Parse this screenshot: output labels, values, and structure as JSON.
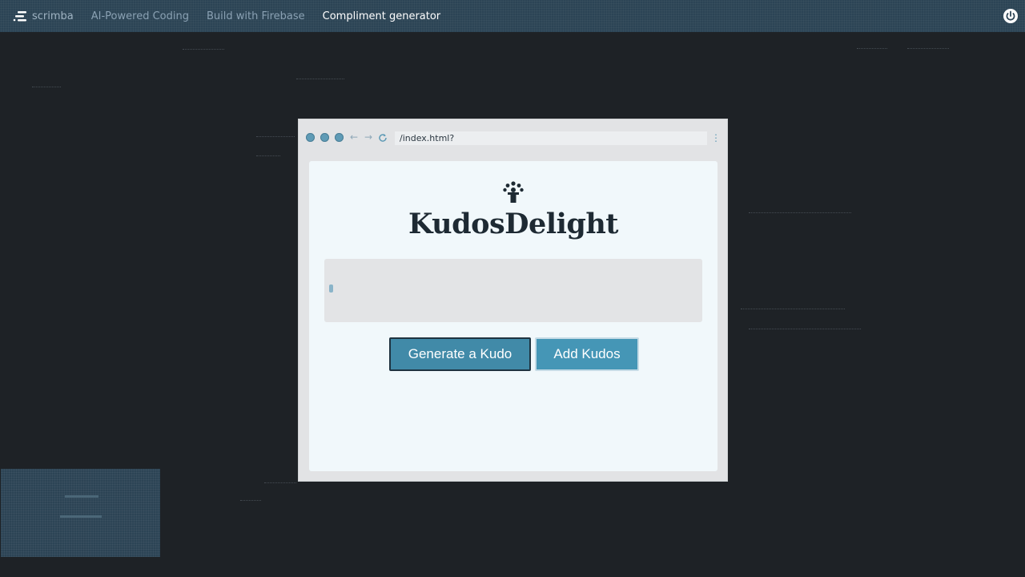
{
  "header": {
    "brand": "scrimba",
    "breadcrumbs": [
      {
        "label": "AI-Powered Coding"
      },
      {
        "label": "Build with Firebase"
      },
      {
        "label": "Compliment generator"
      }
    ]
  },
  "preview": {
    "url": "/index.html?",
    "app": {
      "title": "KudosDelight",
      "textarea_value": "",
      "buttons": {
        "generate": "Generate a Kudo",
        "add": "Add Kudos"
      }
    }
  },
  "icons": {
    "brand": "scrimba-logo-icon",
    "power": "power-icon",
    "logo": "people-celebrate-icon"
  },
  "colors": {
    "background": "#1e2226",
    "header": "#2c4455",
    "accent_button": "#418aa8",
    "page_bg": "#f1f8fb"
  }
}
